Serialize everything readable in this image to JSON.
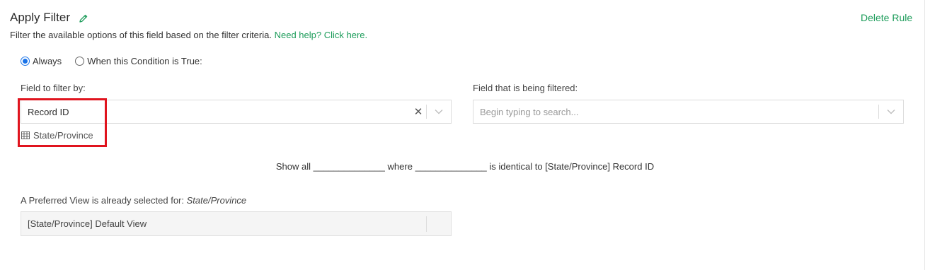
{
  "header": {
    "title": "Apply Filter",
    "delete_label": "Delete Rule"
  },
  "description": {
    "text": "Filter the available options of this field based on the filter criteria. ",
    "help_link": "Need help? Click here."
  },
  "condition": {
    "options": [
      {
        "label": "Always",
        "checked": true
      },
      {
        "label": "When this Condition is True:",
        "checked": false
      }
    ]
  },
  "field_to_filter_by": {
    "label": "Field to filter by:",
    "value": "Record ID",
    "source_table": "State/Province"
  },
  "field_being_filtered": {
    "label": "Field that is being filtered:",
    "placeholder": "Begin typing to search..."
  },
  "summary": {
    "show_all": "Show all",
    "blank1": "______________",
    "where": "where",
    "blank2": "______________",
    "rest": "is identical to [State/Province] Record ID"
  },
  "preferred_view": {
    "label_prefix": "A Preferred View is already selected for: ",
    "table": "State/Province",
    "value": "[State/Province] Default View"
  },
  "colors": {
    "accent_green": "#1c9c5a",
    "radio_blue": "#1a73e8",
    "highlight_red": "#e0141e"
  }
}
